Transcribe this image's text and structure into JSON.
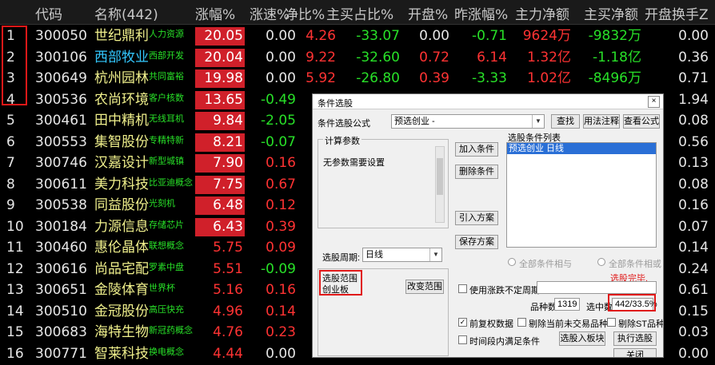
{
  "header": {
    "code": "代码",
    "name": "名称(442)",
    "pct": "涨幅%",
    "speed": "涨速%",
    "net_ratio": "净比%",
    "main_ratio": "主买占比%",
    "open": "开盘%",
    "prev_pct": "昨涨幅%",
    "main_flow": "主力净额",
    "main_buy": "主买净额",
    "open_turn": "开盘换手Z"
  },
  "rows": [
    {
      "no": "1",
      "code": "300050",
      "name": "世纪鼎利",
      "tag": "人力资源",
      "pct": "20.05",
      "speed": "0.00",
      "net": "4.26",
      "main": "-33.07",
      "open": "0.00",
      "prev": "-0.71",
      "flow": "9624万",
      "buy": "-9832万",
      "turn": "0.00"
    },
    {
      "no": "2",
      "code": "300106",
      "name": "西部牧业",
      "tag": "西部开发",
      "pct": "20.04",
      "speed": "0.00",
      "net": "9.22",
      "main": "-32.60",
      "open": "0.72",
      "prev": "6.14",
      "flow": "1.32亿",
      "buy": "-1.18亿",
      "turn": "0.36"
    },
    {
      "no": "3",
      "code": "300649",
      "name": "杭州园林",
      "tag": "共同富裕",
      "pct": "19.98",
      "speed": "0.00",
      "net": "5.92",
      "main": "-26.80",
      "open": "0.39",
      "prev": "-3.33",
      "flow": "1.02亿",
      "buy": "-8496万",
      "turn": "0.71"
    },
    {
      "no": "4",
      "code": "300536",
      "name": "农尚环境",
      "tag": "客户核数",
      "pct": "13.65",
      "speed": "-0.49",
      "net": "",
      "main": "",
      "open": "",
      "prev": "",
      "flow": "",
      "buy": "",
      "turn": "1.94"
    },
    {
      "no": "5",
      "code": "300461",
      "name": "田中精机",
      "tag": "无线耳机",
      "pct": "9.84",
      "speed": "-2.05",
      "net": "",
      "main": "",
      "open": "",
      "prev": "",
      "flow": "",
      "buy": "",
      "turn": "0.08"
    },
    {
      "no": "6",
      "code": "300553",
      "name": "集智股份",
      "tag": "专精特新",
      "pct": "8.21",
      "speed": "-0.07",
      "net": "",
      "main": "",
      "open": "",
      "prev": "",
      "flow": "",
      "buy": "",
      "turn": "0.56"
    },
    {
      "no": "7",
      "code": "300746",
      "name": "汉嘉设计",
      "tag": "新型城镇",
      "pct": "7.90",
      "speed": "0.16",
      "net": "",
      "main": "",
      "open": "",
      "prev": "",
      "flow": "",
      "buy": "",
      "turn": "0.13"
    },
    {
      "no": "8",
      "code": "300611",
      "name": "美力科技",
      "tag": "比亚迪概念",
      "pct": "7.75",
      "speed": "0.67",
      "net": "",
      "main": "",
      "open": "",
      "prev": "",
      "flow": "",
      "buy": "",
      "turn": "0.08"
    },
    {
      "no": "9",
      "code": "300538",
      "name": "同益股份",
      "tag": "光刻机",
      "pct": "6.48",
      "speed": "0.12",
      "net": "",
      "main": "",
      "open": "",
      "prev": "",
      "flow": "",
      "buy": "",
      "turn": "0.16"
    },
    {
      "no": "10",
      "code": "300184",
      "name": "力源信息",
      "tag": "存储芯片",
      "pct": "6.43",
      "speed": "0.39",
      "net": "",
      "main": "",
      "open": "",
      "prev": "",
      "flow": "",
      "buy": "",
      "turn": "0.07"
    },
    {
      "no": "11",
      "code": "300460",
      "name": "惠伦晶体",
      "tag": "联想概念",
      "pct": "5.75",
      "speed": "0.09",
      "net": "",
      "main": "",
      "open": "",
      "prev": "",
      "flow": "",
      "buy": "",
      "turn": "0.14"
    },
    {
      "no": "12",
      "code": "300616",
      "name": "尚品宅配",
      "tag": "罗素中盘",
      "pct": "5.51",
      "speed": "-0.09",
      "net": "",
      "main": "",
      "open": "",
      "prev": "",
      "flow": "",
      "buy": "",
      "turn": "0.24"
    },
    {
      "no": "13",
      "code": "300651",
      "name": "金陵体育",
      "tag": "世界杯",
      "pct": "5.16",
      "speed": "0.16",
      "net": "",
      "main": "",
      "open": "",
      "prev": "",
      "flow": "",
      "buy": "",
      "turn": "0.61"
    },
    {
      "no": "14",
      "code": "300510",
      "name": "金冠股份",
      "tag": "高压快充",
      "pct": "4.96",
      "speed": "0.14",
      "net": "",
      "main": "",
      "open": "",
      "prev": "",
      "flow": "",
      "buy": "",
      "turn": "0.15"
    },
    {
      "no": "15",
      "code": "300683",
      "name": "海特生物",
      "tag": "新冠药概念",
      "pct": "4.76",
      "speed": "0.23",
      "net": "",
      "main": "",
      "open": "",
      "prev": "",
      "flow": "",
      "buy": "",
      "turn": "0.03"
    },
    {
      "no": "16",
      "code": "300771",
      "name": "智莱科技",
      "tag": "换电概念",
      "pct": "4.44",
      "speed": "0.00",
      "net": "",
      "main": "",
      "open": "",
      "prev": "",
      "flow": "",
      "buy": "",
      "turn": "0.00"
    }
  ],
  "dialog": {
    "title": "条件选股",
    "close": "×",
    "formula_label": "条件选股公式",
    "formula_value": "预选创业 -",
    "btn_find": "查找",
    "btn_usage": "用法注释",
    "btn_view": "查看公式",
    "params_title": "计算参数",
    "params_text": "无参数需要设置",
    "btn_add": "加入条件",
    "btn_delete": "删除条件",
    "btn_import": "引入方案",
    "btn_save": "保存方案",
    "cond_list_title": "选股条件列表",
    "cond_list_items": [
      "预选创业 日线"
    ],
    "period_label": "选股周期:",
    "period_value": "日线",
    "radio_and": "全部条件相与",
    "radio_or": "全部条件相或",
    "status": "选股完毕.",
    "range_title": "选股范围",
    "range_value": "创业板",
    "btn_change_range": "改变范围",
    "chk_uncertain": "使用涨跌不定周期",
    "count_label": "品种数",
    "count_value": "1319",
    "selected_label": "选中数",
    "selected_value": "442/33.5%",
    "chk_prefq": "前复权数据",
    "chk_exclude_untraded": "剔除当前未交易品种",
    "chk_exclude_st": "剔除ST品种",
    "chk_period_any": "时间段内满足条件",
    "btn_into_block": "选股入板块",
    "btn_execute": "执行选股",
    "btn_close": "关闭"
  },
  "colors": {
    "background": "#000000",
    "up": "#ff3333",
    "down": "#28e028",
    "highlight_box": "#e01818",
    "cell_red": "#d0202a"
  }
}
